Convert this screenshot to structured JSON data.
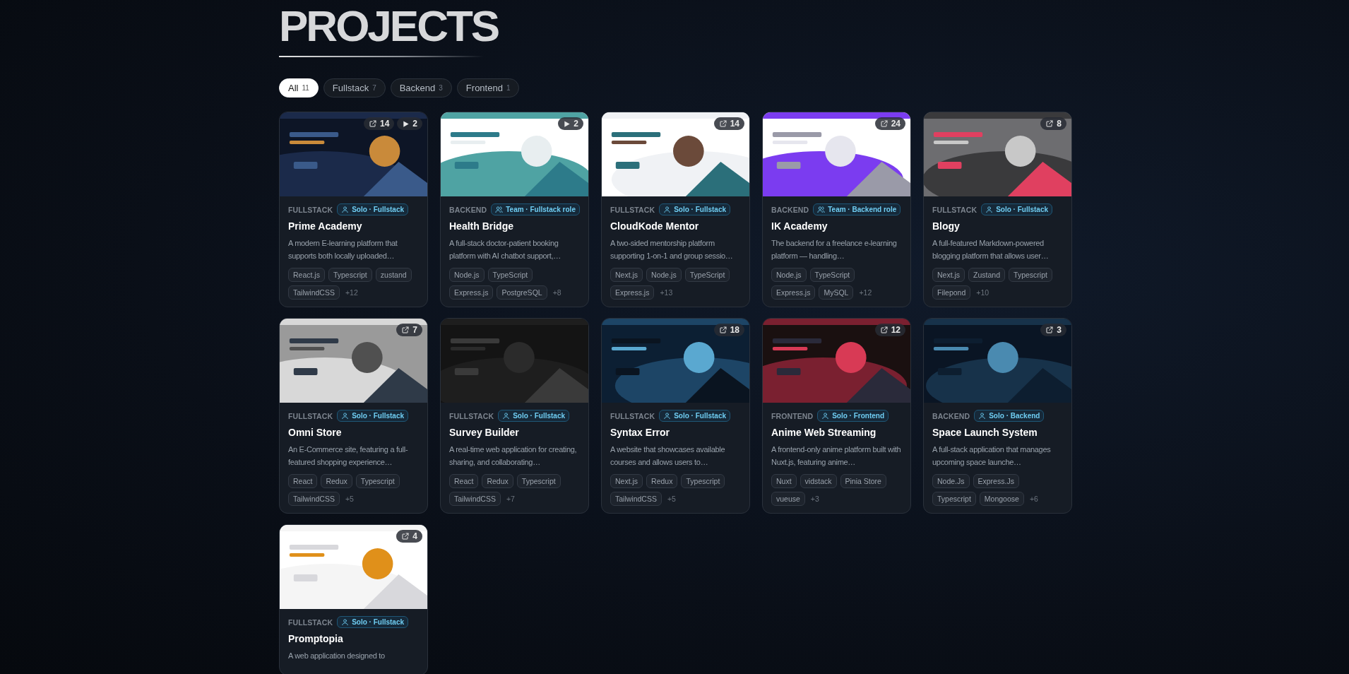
{
  "heading": "PROJECTS",
  "filters": [
    {
      "label": "All",
      "count": "11",
      "selected": true
    },
    {
      "label": "Fullstack",
      "count": "7",
      "selected": false
    },
    {
      "label": "Backend",
      "count": "3",
      "selected": false
    },
    {
      "label": "Frontend",
      "count": "1",
      "selected": false
    }
  ],
  "projects": [
    {
      "counters": [
        {
          "kind": "link",
          "count": "14"
        },
        {
          "kind": "video",
          "count": "2"
        }
      ],
      "category": "FULLSTACK",
      "role": {
        "kind": "solo",
        "label": "Solo · Fullstack"
      },
      "title": "Prime Academy",
      "description": "A modern E-learning platform that supports both locally uploaded…",
      "tags": [
        "React.js",
        "Typescript",
        "zustand",
        "TailwindCSS"
      ],
      "more": "+12"
    },
    {
      "counters": [
        {
          "kind": "video",
          "count": "2"
        }
      ],
      "category": "BACKEND",
      "role": {
        "kind": "team",
        "label": "Team · Fullstack role"
      },
      "title": "Health Bridge",
      "description": "A full-stack doctor-patient booking platform with AI chatbot support,…",
      "tags": [
        "Node.js",
        "TypeScript",
        "Express.js",
        "PostgreSQL"
      ],
      "more": "+8"
    },
    {
      "counters": [
        {
          "kind": "link",
          "count": "14"
        }
      ],
      "category": "FULLSTACK",
      "role": {
        "kind": "solo",
        "label": "Solo · Fullstack"
      },
      "title": "CloudKode Mentor",
      "description": "A two-sided mentorship platform supporting 1-on-1 and group sessio…",
      "tags": [
        "Next.js",
        "Node.js",
        "TypeScript",
        "Express.js"
      ],
      "more": "+13"
    },
    {
      "counters": [
        {
          "kind": "link",
          "count": "24"
        }
      ],
      "category": "BACKEND",
      "role": {
        "kind": "team",
        "label": "Team · Backend role"
      },
      "title": "IK Academy",
      "description": "The backend for a freelance e-learning platform — handling…",
      "tags": [
        "Node.js",
        "TypeScript",
        "Express.js",
        "MySQL"
      ],
      "more": "+12"
    },
    {
      "counters": [
        {
          "kind": "link",
          "count": "8"
        }
      ],
      "category": "FULLSTACK",
      "role": {
        "kind": "solo",
        "label": "Solo · Fullstack"
      },
      "title": "Blogy",
      "description": "A full-featured Markdown-powered blogging platform that allows user…",
      "tags": [
        "Next.js",
        "Zustand",
        "Typescript",
        "Filepond"
      ],
      "more": "+10"
    },
    {
      "counters": [
        {
          "kind": "link",
          "count": "7"
        }
      ],
      "category": "FULLSTACK",
      "role": {
        "kind": "solo",
        "label": "Solo · Fullstack"
      },
      "title": "Omni Store",
      "description": "An E-Commerce site, featuring a full-featured shopping experience…",
      "tags": [
        "React",
        "Redux",
        "Typescript",
        "TailwindCSS"
      ],
      "more": "+5"
    },
    {
      "category": "FULLSTACK",
      "role": {
        "kind": "solo",
        "label": "Solo · Fullstack"
      },
      "title": "Survey Builder",
      "description": "A real-time web application for creating, sharing, and collaborating…",
      "tags": [
        "React",
        "Redux",
        "Typescript",
        "TailwindCSS"
      ],
      "more": "+7"
    },
    {
      "counters": [
        {
          "kind": "link",
          "count": "18"
        }
      ],
      "category": "FULLSTACK",
      "role": {
        "kind": "solo",
        "label": "Solo · Fullstack"
      },
      "title": "Syntax Error",
      "description": "A website that showcases available courses and allows users to…",
      "tags": [
        "Next.js",
        "Redux",
        "Typescript",
        "TailwindCSS"
      ],
      "more": "+5"
    },
    {
      "counters": [
        {
          "kind": "link",
          "count": "12"
        }
      ],
      "category": "FRONTEND",
      "role": {
        "kind": "solo",
        "label": "Solo · Frontend"
      },
      "title": "Anime Web Streaming",
      "description": "A frontend-only anime platform built with Nuxt.js, featuring anime…",
      "tags": [
        "Nuxt",
        "vidstack",
        "Pinia Store",
        "vueuse"
      ],
      "more": "+3"
    },
    {
      "counters": [
        {
          "kind": "link",
          "count": "3"
        }
      ],
      "category": "BACKEND",
      "role": {
        "kind": "solo",
        "label": "Solo · Backend"
      },
      "title": "Space Launch System",
      "description": "A full-stack application that manages upcoming space launche…",
      "tags": [
        "Node.Js",
        "Express.Js",
        "Typescript",
        "Mongoose"
      ],
      "more": "+6"
    },
    {
      "counters": [
        {
          "kind": "link",
          "count": "4"
        }
      ],
      "category": "FULLSTACK",
      "role": {
        "kind": "solo",
        "label": "Solo · Fullstack"
      },
      "title": "Promptopia",
      "description": "A web application designed to"
    }
  ]
}
